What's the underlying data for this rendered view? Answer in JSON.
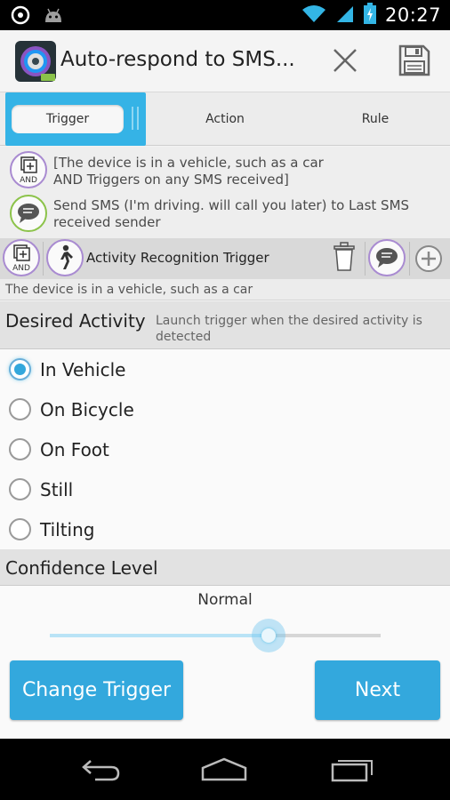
{
  "status_bar": {
    "time": "20:27"
  },
  "action_bar": {
    "title": "Auto-respond to SMS..."
  },
  "tabs": [
    {
      "label": "Trigger",
      "active": true
    },
    {
      "label": "Action",
      "active": false
    },
    {
      "label": "Rule",
      "active": false
    }
  ],
  "summary": {
    "trigger_text": "[The device is in a vehicle, such as a car\n AND Triggers on any SMS received]",
    "action_text": "Send SMS (I'm driving. will call you later) to Last SMS\nreceived sender",
    "and_label": "AND"
  },
  "trigger_row": {
    "label": "Activity Recognition Trigger",
    "and_label": "AND"
  },
  "description": "The device is in a vehicle, such as a car",
  "desired_activity": {
    "title": "Desired Activity",
    "subtitle": "Launch trigger when the desired activity is detected",
    "options": [
      "In Vehicle",
      "On Bicycle",
      "On Foot",
      "Still",
      "Tilting"
    ],
    "selected": "In Vehicle"
  },
  "confidence": {
    "title": "Confidence Level",
    "value_label": "Normal",
    "level": 0.66
  },
  "buttons": {
    "change_trigger": "Change Trigger",
    "next": "Next"
  },
  "colors": {
    "accent": "#33a8dd",
    "and_ring": "#a98bd1",
    "action_ring": "#8cc34a"
  }
}
